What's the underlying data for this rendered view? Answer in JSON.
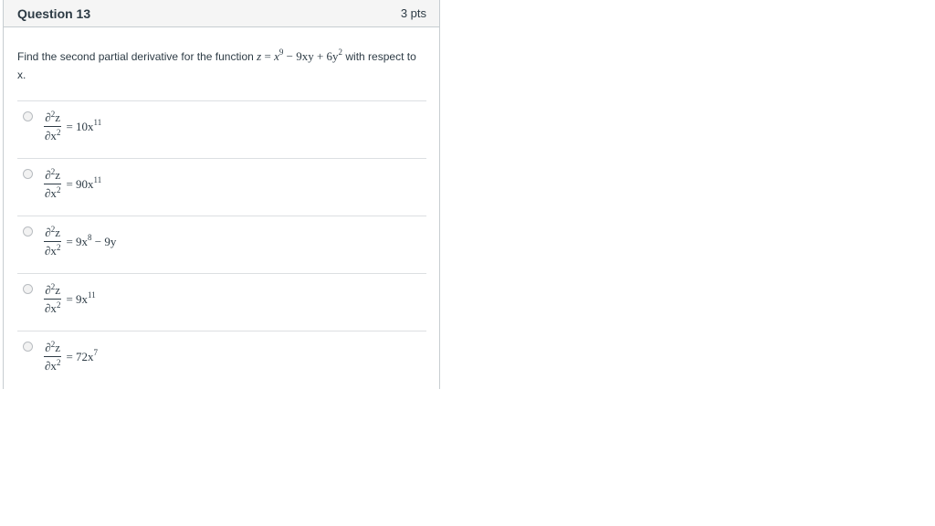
{
  "question": {
    "title": "Question 13",
    "points": "3 pts",
    "prompt_before": "Find the second partial derivative for the function",
    "prompt_after": "with respect to x.",
    "function": {
      "z": "z",
      "eq": " = ",
      "x": "x",
      "exp1": "9",
      "term2": " − 9xy + 6y",
      "exp2": "2"
    }
  },
  "derivative": {
    "num_base": "∂",
    "num_exp": "2",
    "num_var": "z",
    "den_base": "∂x",
    "den_exp": "2"
  },
  "answers": [
    {
      "rhs_base": "= 10x",
      "rhs_exp": "11",
      "rhs_tail": ""
    },
    {
      "rhs_base": "= 90x",
      "rhs_exp": "11",
      "rhs_tail": ""
    },
    {
      "rhs_base": "= 9x",
      "rhs_exp": "8",
      "rhs_tail": " − 9y"
    },
    {
      "rhs_base": "= 9x",
      "rhs_exp": "11",
      "rhs_tail": ""
    },
    {
      "rhs_base": "= 72x",
      "rhs_exp": "7",
      "rhs_tail": ""
    }
  ]
}
